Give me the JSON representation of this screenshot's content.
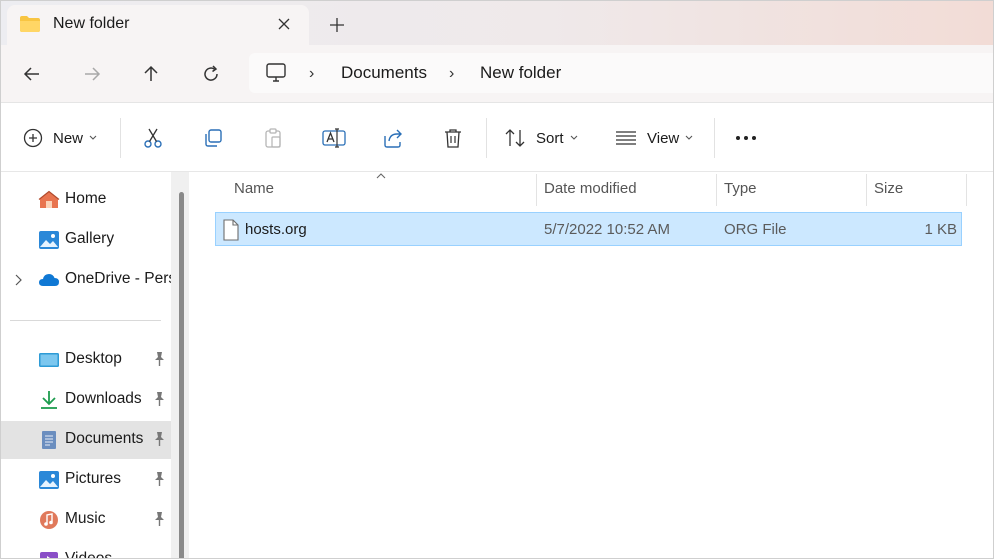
{
  "tab": {
    "title": "New folder"
  },
  "address": {
    "crumbs": [
      "Documents",
      "New folder"
    ]
  },
  "toolbar": {
    "new_label": "New",
    "sort_label": "Sort",
    "view_label": "View"
  },
  "sidebar": {
    "items": [
      {
        "label": "Home",
        "icon": "home-icon"
      },
      {
        "label": "Gallery",
        "icon": "gallery-icon"
      },
      {
        "label": "OneDrive - Perso",
        "icon": "onedrive-icon"
      },
      {
        "label": "Desktop",
        "icon": "desktop-icon"
      },
      {
        "label": "Downloads",
        "icon": "downloads-icon"
      },
      {
        "label": "Documents",
        "icon": "documents-icon"
      },
      {
        "label": "Pictures",
        "icon": "pictures-icon"
      },
      {
        "label": "Music",
        "icon": "music-icon"
      },
      {
        "label": "Videos",
        "icon": "videos-icon"
      }
    ]
  },
  "columns": {
    "name": "Name",
    "date": "Date modified",
    "type": "Type",
    "size": "Size"
  },
  "files": [
    {
      "name": "hosts.org",
      "date": "5/7/2022 10:52 AM",
      "type": "ORG File",
      "size": "1 KB"
    }
  ],
  "colors": {
    "selection": "#cce8ff",
    "selection_border": "#99d1ff",
    "folder": "#f8c542",
    "accent": "#0067c0"
  }
}
